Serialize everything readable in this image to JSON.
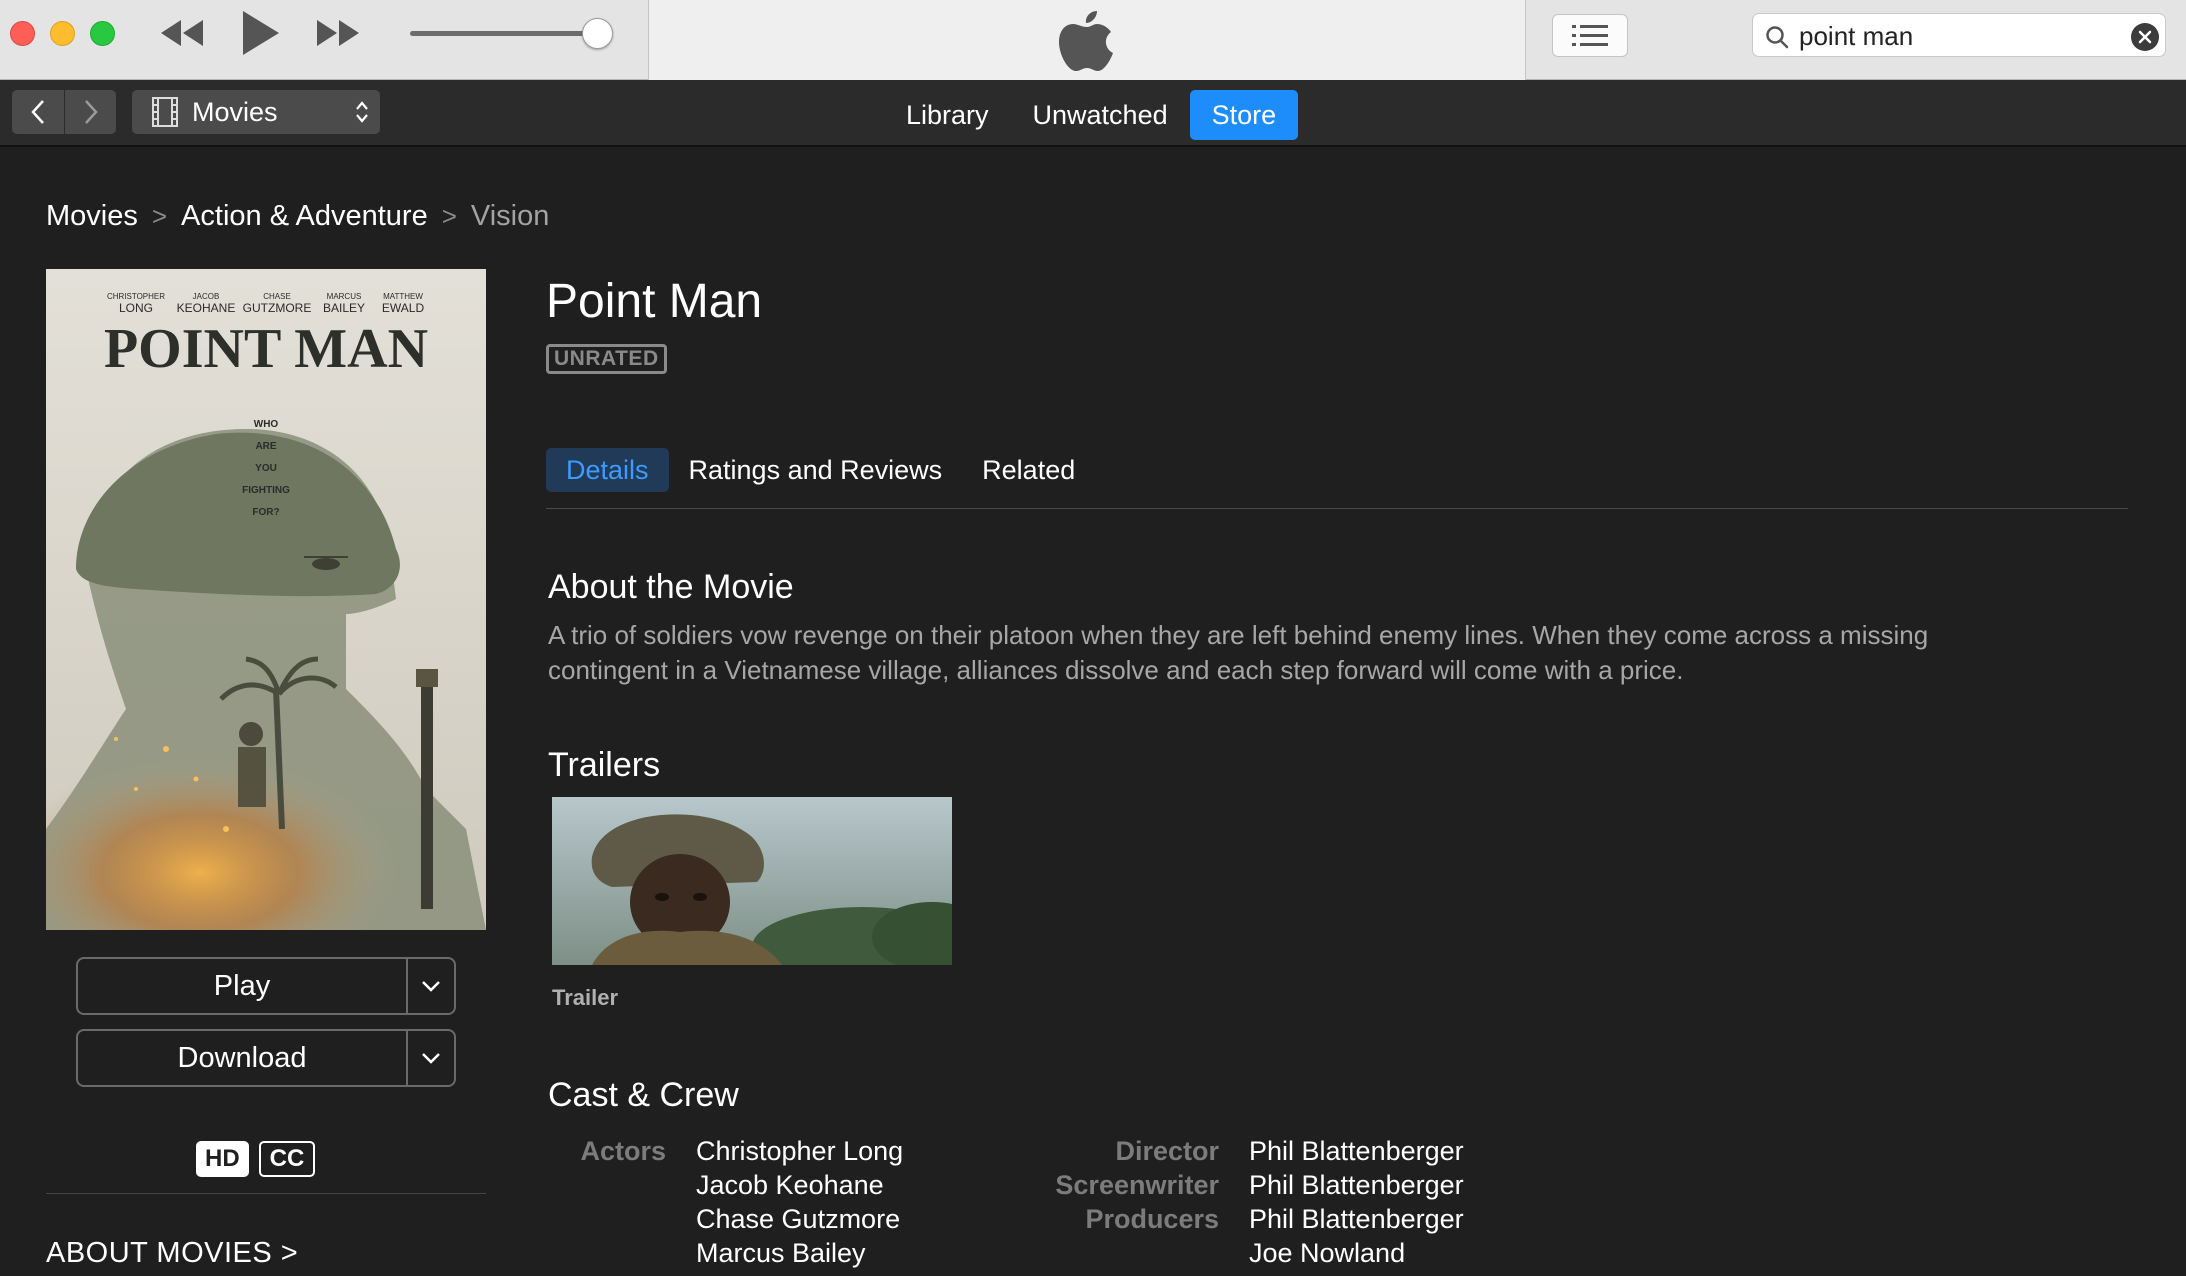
{
  "toolbar": {
    "search_value": "point man"
  },
  "navbar": {
    "media_type": "Movies",
    "tabs": [
      {
        "label": "Library",
        "active": false
      },
      {
        "label": "Unwatched",
        "active": false
      },
      {
        "label": "Store",
        "active": true
      }
    ]
  },
  "breadcrumb": {
    "items": [
      "Movies",
      "Action & Adventure",
      "Vision"
    ]
  },
  "movie": {
    "title": "Point Man",
    "rating": "UNRATED",
    "poster": {
      "cast_names": [
        {
          "first": "CHRISTOPHER",
          "last": "LONG"
        },
        {
          "first": "JACOB",
          "last": "KEOHANE"
        },
        {
          "first": "CHASE",
          "last": "GUTZMORE"
        },
        {
          "first": "MARCUS",
          "last": "BAILEY"
        },
        {
          "first": "MATTHEW",
          "last": "EWALD"
        }
      ],
      "title": "POINT MAN",
      "tagline": [
        "WHO",
        "ARE",
        "YOU",
        "FIGHTING",
        "FOR?"
      ]
    }
  },
  "actions": {
    "play_label": "Play",
    "download_label": "Download",
    "badge_hd": "HD",
    "badge_cc": "CC",
    "about_link": "ABOUT MOVIES >"
  },
  "detail_tabs": [
    {
      "label": "Details",
      "active": true
    },
    {
      "label": "Ratings and Reviews",
      "active": false
    },
    {
      "label": "Related",
      "active": false
    }
  ],
  "about": {
    "heading": "About the Movie",
    "text": "A trio of soldiers vow revenge on their platoon when they are left behind enemy lines. When they come across a missing contingent in a Vietnamese village, alliances dissolve and each step forward will come with a price."
  },
  "trailers": {
    "heading": "Trailers",
    "items": [
      {
        "label": "Trailer"
      }
    ]
  },
  "cast_crew": {
    "heading": "Cast & Crew",
    "actors_label": "Actors",
    "actors": [
      "Christopher Long",
      "Jacob Keohane",
      "Chase Gutzmore",
      "Marcus Bailey"
    ],
    "crew": [
      {
        "role": "Director",
        "name": "Phil Blattenberger"
      },
      {
        "role": "Screenwriter",
        "name": "Phil Blattenberger"
      },
      {
        "role": "Producers",
        "name": "Phil Blattenberger"
      },
      {
        "role": "",
        "name": "Joe Nowland"
      }
    ]
  },
  "colors": {
    "accent": "#1d8dfb",
    "background": "#1f1f1f",
    "titlebar": "#e4e4e4"
  }
}
